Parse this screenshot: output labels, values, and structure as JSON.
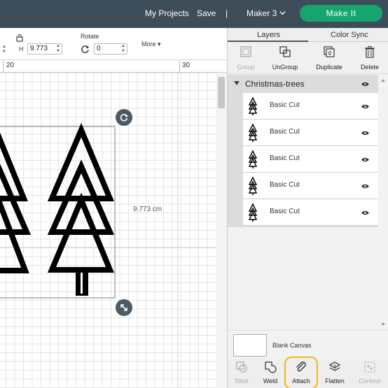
{
  "topbar": {
    "my_projects": "My Projects",
    "save": "Save",
    "divider": "|",
    "machine": "Maker 3",
    "make_it": "Make It",
    "colors": {
      "bar": "#3d4d5a",
      "make_it": "#16a56f"
    }
  },
  "toolbar": {
    "lock_icon": "lock-icon",
    "h_label": "H",
    "h_value": "9.773",
    "rotate_label": "Rotate",
    "rotate_value": "0",
    "more_label": "More"
  },
  "ruler": {
    "labels": [
      "20",
      "30"
    ]
  },
  "canvas": {
    "dimension_label": "9.773 cm",
    "grid_color": "#e4e4e4"
  },
  "panel": {
    "tabs": [
      {
        "label": "Layers",
        "active": true
      },
      {
        "label": "Color Sync",
        "active": false
      }
    ],
    "actions": [
      {
        "label": "Group",
        "icon": "group-icon",
        "enabled": false
      },
      {
        "label": "UnGroup",
        "icon": "ungroup-icon",
        "enabled": true
      },
      {
        "label": "Duplicate",
        "icon": "duplicate-icon",
        "enabled": true
      },
      {
        "label": "Delete",
        "icon": "trash-icon",
        "enabled": true
      }
    ],
    "group_name": "Christmas-trees",
    "layers": [
      {
        "label": "Basic Cut"
      },
      {
        "label": "Basic Cut"
      },
      {
        "label": "Basic Cut"
      },
      {
        "label": "Basic Cut"
      },
      {
        "label": "Basic Cut"
      }
    ],
    "blank_canvas_label": "Blank Canvas",
    "bottom_actions": [
      {
        "label": "Slice",
        "icon": "slice-icon",
        "enabled": false
      },
      {
        "label": "Weld",
        "icon": "weld-icon",
        "enabled": true
      },
      {
        "label": "Attach",
        "icon": "attach-icon",
        "enabled": true,
        "highlighted": true
      },
      {
        "label": "Flatten",
        "icon": "flatten-icon",
        "enabled": true
      },
      {
        "label": "Contour",
        "icon": "contour-icon",
        "enabled": false
      }
    ],
    "highlight_color": "#f0b81c"
  }
}
